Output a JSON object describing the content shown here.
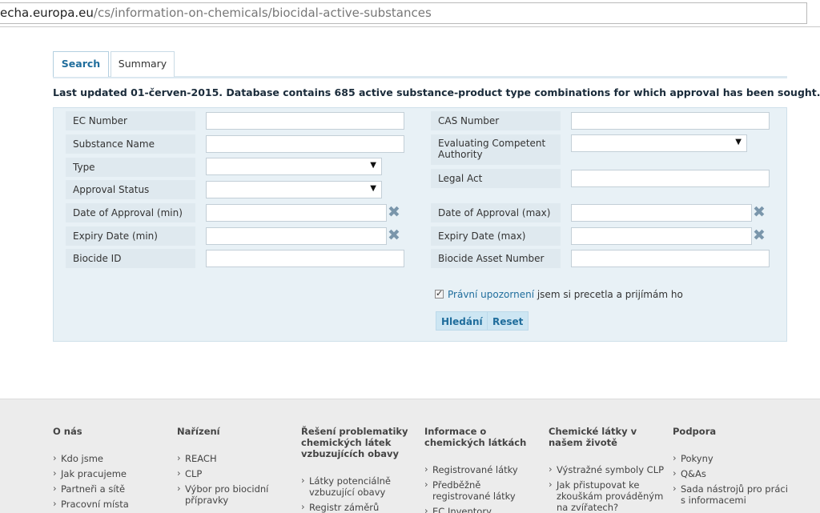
{
  "url": {
    "domain": "echa.europa.eu",
    "path": "/cs/information-on-chemicals/biocidal-active-substances"
  },
  "tabs": [
    {
      "label": "Search"
    },
    {
      "label": "Summary"
    }
  ],
  "last_updated": "Last updated 01-červen-2015. Database contains 685 active substance-product type combinations for which approval has been sought.",
  "form": {
    "ec_number": "EC Number",
    "substance_name": "Substance Name",
    "type": "Type",
    "approval_status": "Approval Status",
    "date_approval_min": "Date of Approval (min)",
    "expiry_min": "Expiry Date (min)",
    "biocide_id": "Biocide ID",
    "cas_number": "CAS Number",
    "eval_authority_line1": "Evaluating Competent",
    "eval_authority_line2": "Authority",
    "legal_act": "Legal Act",
    "date_approval_max": "Date of Approval (max)",
    "expiry_max": "Expiry Date (max)",
    "biocide_asset": "Biocide Asset Number"
  },
  "agree": {
    "link": "Právní upozornení",
    "text": " jsem si precetla a prijímám ho",
    "checked": true
  },
  "buttons": {
    "search": "Hledání",
    "reset": "Reset"
  },
  "footer": [
    {
      "title": "O nás",
      "items": [
        "Kdo jsme",
        "Jak pracujeme",
        "Partneři a sítě",
        "Pracovní místa"
      ]
    },
    {
      "title": "Nařízení",
      "items": [
        "REACH",
        "CLP",
        "Výbor pro biocidní přípravky"
      ]
    },
    {
      "title": "Řešení problematiky chemických látek vzbuzujících obavy",
      "items": [
        "Látky potenciálně vzbuzující obavy",
        "Registr záměrů"
      ]
    },
    {
      "title": "Informace o chemických látkách",
      "items": [
        "Registrované látky",
        "Předběžně registrované látky",
        "EC Inventory"
      ]
    },
    {
      "title": "Chemické látky v našem životě",
      "items": [
        "Výstražné symboly CLP",
        "Jak přistupovat ke zkouškám prováděným na zvířatech?"
      ]
    },
    {
      "title": "Podpora",
      "items": [
        "Pokyny",
        "Q&As",
        "Sada nástrojů pro práci s informacemi"
      ]
    }
  ]
}
